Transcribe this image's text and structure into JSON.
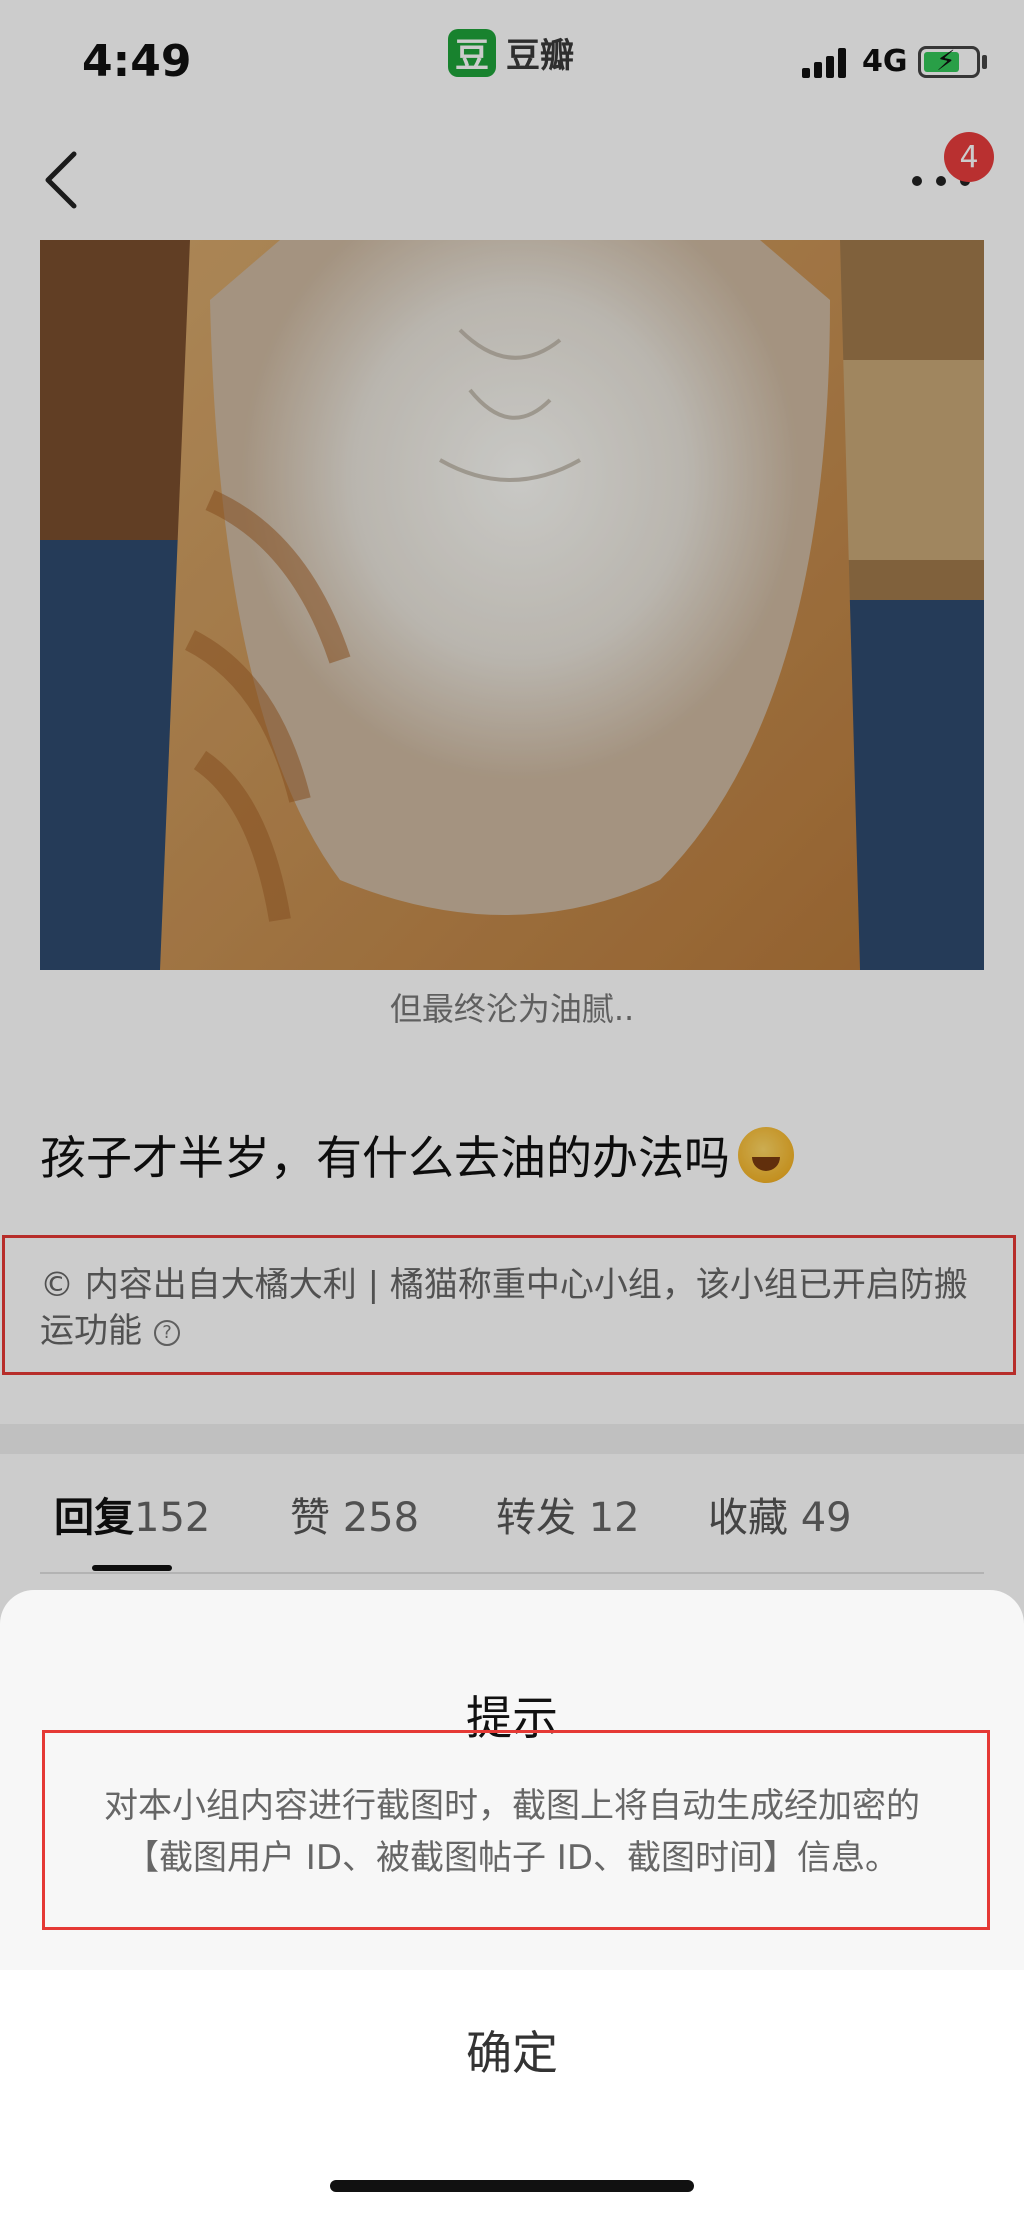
{
  "status_bar": {
    "time": "4:49",
    "app_logo_glyph": "豆",
    "app_name": "豆瓣",
    "network": "4G",
    "battery_level": 0.7
  },
  "header": {
    "back_icon": "chevron-left-icon",
    "more_icon": "more-dots-icon",
    "notification_count": "4"
  },
  "post": {
    "photo_caption": "但最终沦为油腻..",
    "title": "孩子才半岁，有什么去油的办法吗",
    "title_emoji": "sweat-smile-emoji",
    "copyright_notice": "© 内容出自大橘大利 | 橘猫称重中心小组，该小组已开启防搬运功能",
    "help_icon_glyph": "?"
  },
  "tabs": [
    {
      "label": "回复",
      "count": "152",
      "active": true
    },
    {
      "label": "赞",
      "count": "258",
      "active": false
    },
    {
      "label": "转发",
      "count": "12",
      "active": false
    },
    {
      "label": "收藏",
      "count": "49",
      "active": false
    }
  ],
  "dialog": {
    "title": "提示",
    "message_line1": "对本小组内容进行截图时，截图上将自动生成经加密的",
    "message_line2": "【截图用户 ID、被截图帖子 ID、截图时间】信息。",
    "confirm_label": "确定"
  },
  "colors": {
    "brand_green": "#1fa33a",
    "badge_red": "#e83d3d",
    "highlight_red": "#e53935"
  }
}
